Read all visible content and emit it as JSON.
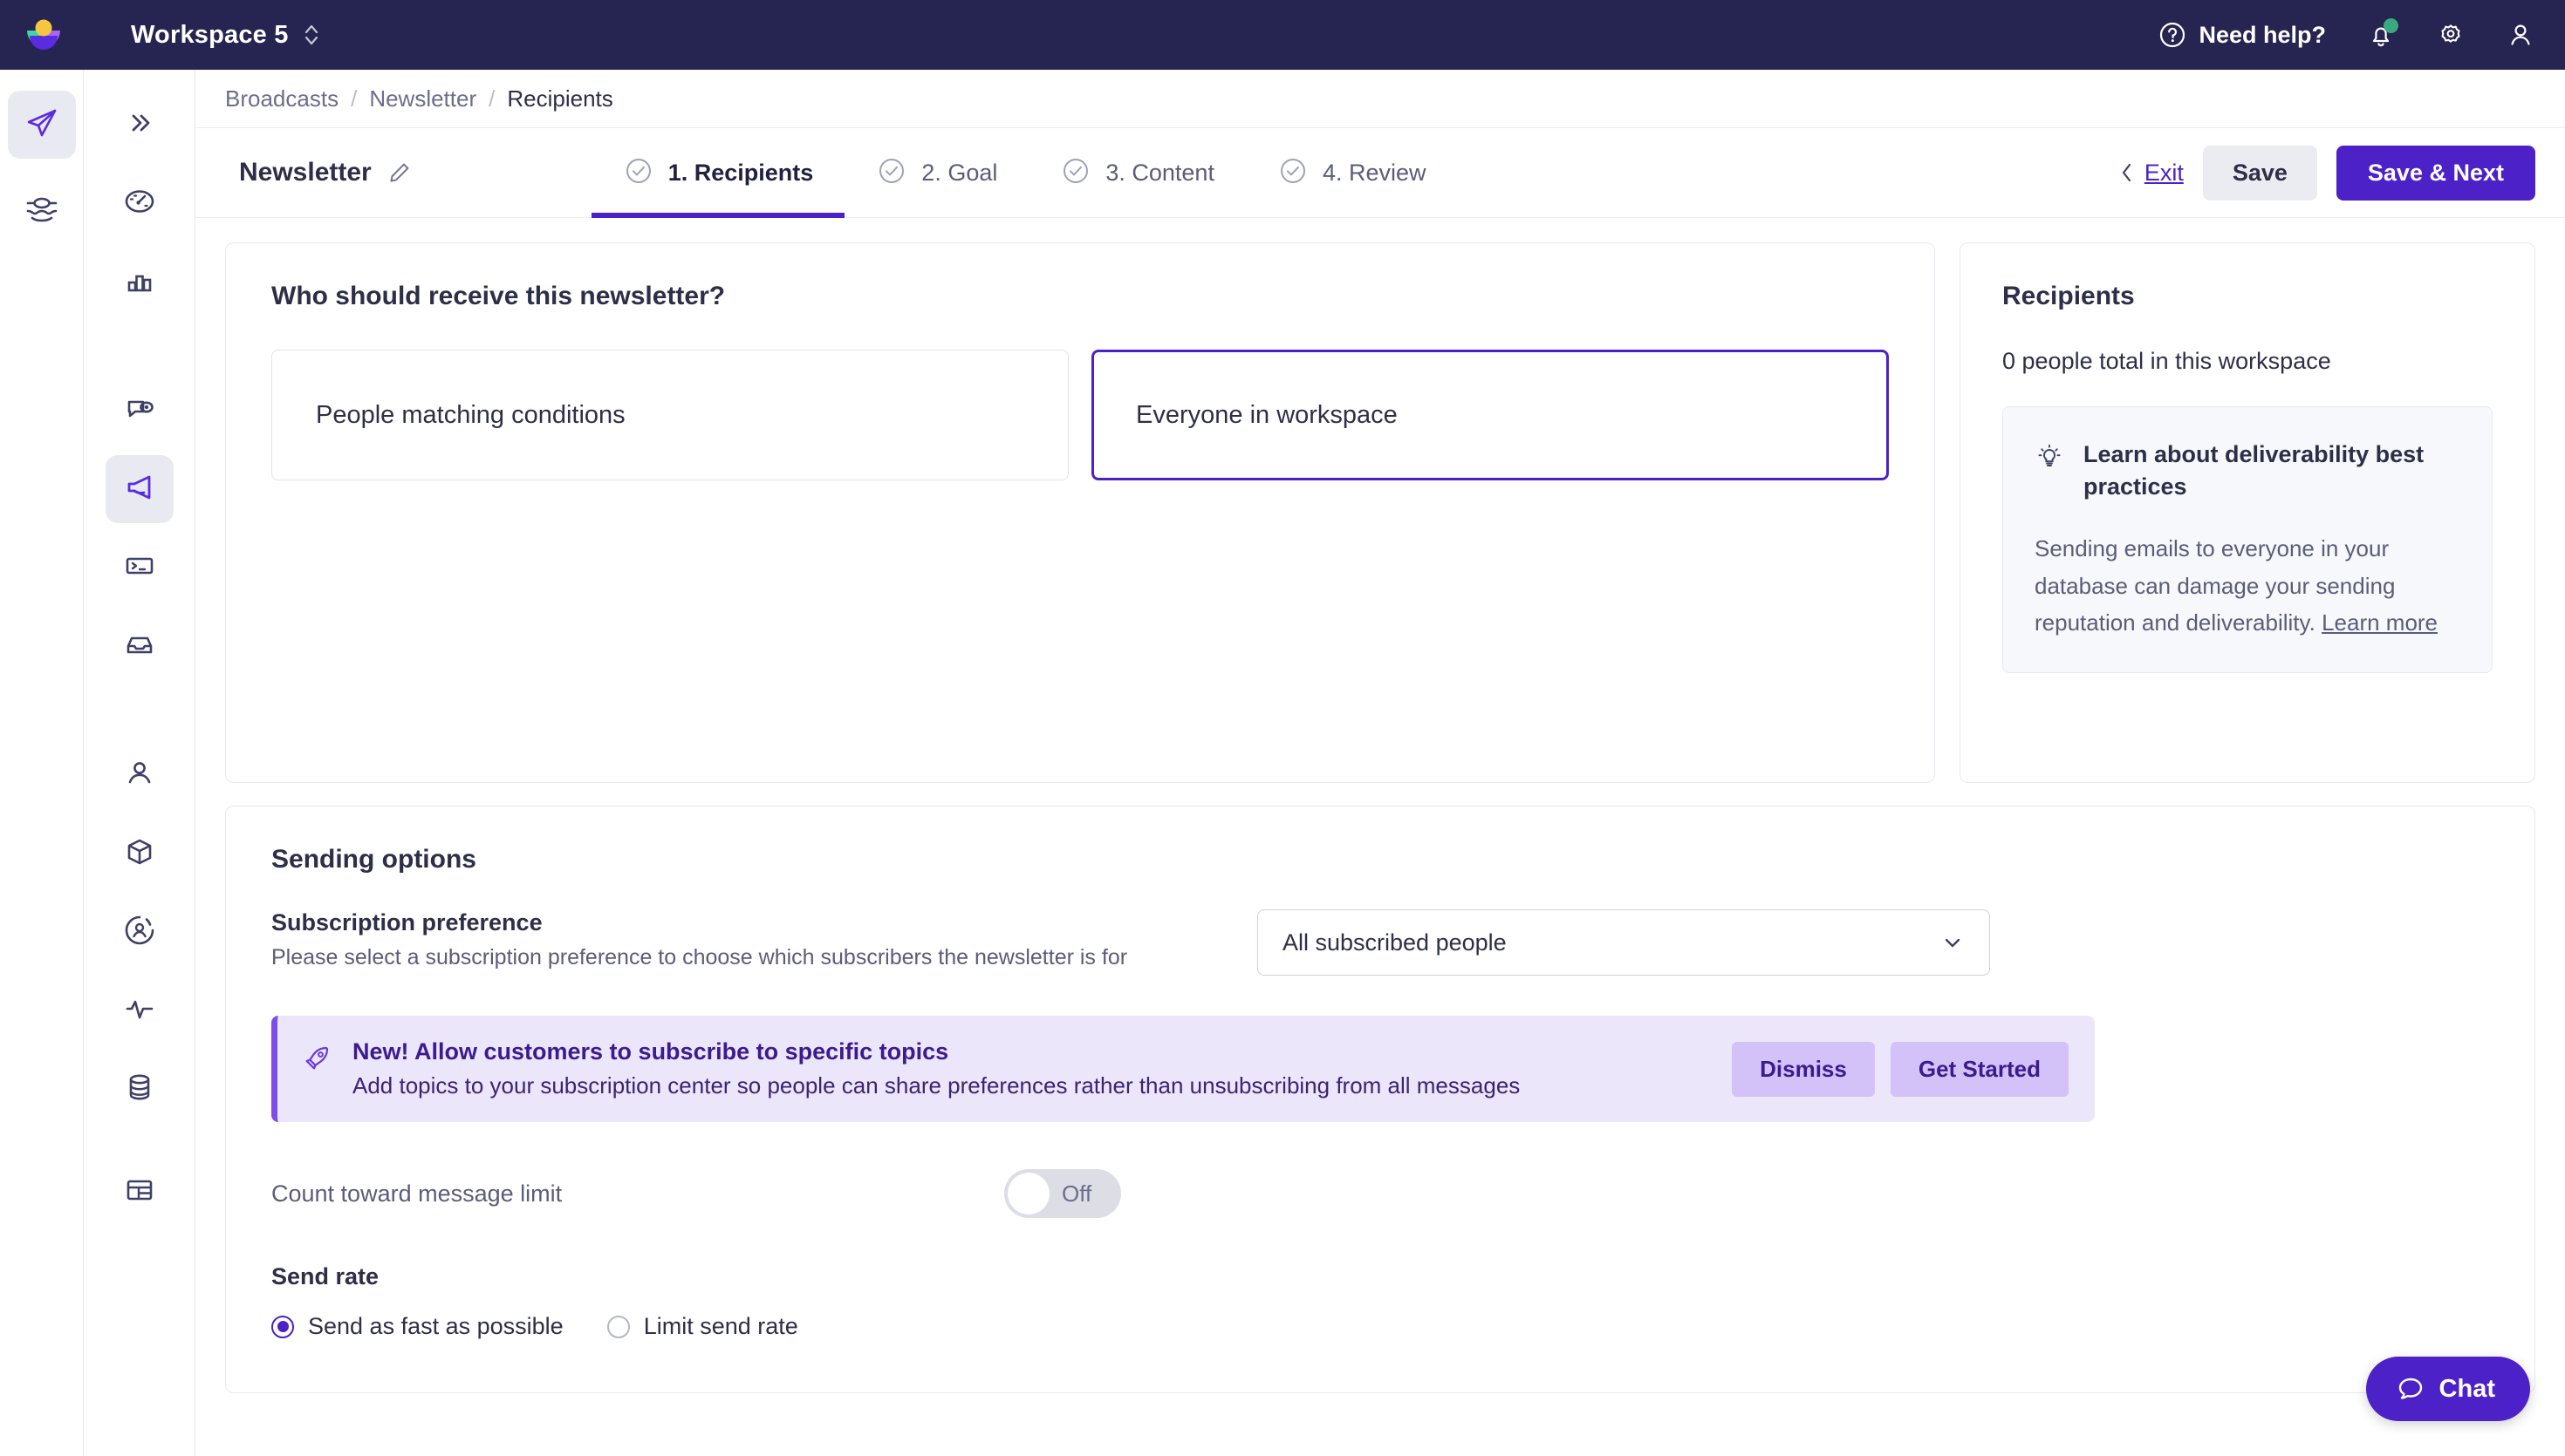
{
  "topbar": {
    "logo_icon": "app-logo",
    "workspace_name": "Workspace 5",
    "workspace_switch_icon": "chevron-updown-icon",
    "need_help_label": "Need help?",
    "help_icon": "question-circle-icon",
    "notifications_icon": "bell-icon",
    "settings_icon": "gear-icon",
    "account_icon": "user-icon"
  },
  "rail_a": {
    "items": [
      {
        "icon": "paper-plane-icon",
        "active": true
      },
      {
        "icon": "layers-icon",
        "active": false
      }
    ]
  },
  "rail_b": {
    "items": [
      {
        "icon": "chevrons-right-icon",
        "active": false
      },
      {
        "icon": "gauge-icon",
        "active": false
      },
      {
        "icon": "bar-chart-icon",
        "active": false
      },
      {
        "icon": "message-eye-icon",
        "active": false
      },
      {
        "icon": "megaphone-icon",
        "active": true
      },
      {
        "icon": "terminal-icon",
        "active": false
      },
      {
        "icon": "inbox-icon",
        "active": false
      },
      {
        "icon": "person-icon",
        "active": false
      },
      {
        "icon": "box-icon",
        "active": false
      },
      {
        "icon": "user-circle-icon",
        "active": false
      },
      {
        "icon": "activity-icon",
        "active": false
      },
      {
        "icon": "database-icon",
        "active": false
      },
      {
        "icon": "table-layout-icon",
        "active": false
      }
    ]
  },
  "breadcrumb": {
    "items": [
      "Broadcasts",
      "Newsletter",
      "Recipients"
    ],
    "separator": "/"
  },
  "wizard": {
    "doc_title": "Newsletter",
    "edit_icon": "pencil-icon",
    "steps": [
      {
        "label": "1. Recipients",
        "icon": "check-circle-icon",
        "active": true
      },
      {
        "label": "2. Goal",
        "icon": "check-circle-icon",
        "active": false
      },
      {
        "label": "3. Content",
        "icon": "check-circle-icon",
        "active": false
      },
      {
        "label": "4. Review",
        "icon": "check-circle-icon",
        "active": false
      }
    ],
    "exit_label": "Exit",
    "exit_icon": "chevron-left-icon",
    "save_label": "Save",
    "save_next_label": "Save & Next"
  },
  "recipients_card": {
    "heading": "Who should receive this newsletter?",
    "choices": [
      {
        "label": "People matching conditions",
        "selected": false
      },
      {
        "label": "Everyone in workspace",
        "selected": true
      }
    ]
  },
  "summary_panel": {
    "title": "Recipients",
    "count_text": "0 people total in this workspace",
    "tip": {
      "icon": "lightbulb-icon",
      "title": "Learn about deliverability best practices",
      "body": "Sending emails to everyone in your database can damage your sending reputation and deliverability.",
      "link_label": "Learn more"
    }
  },
  "sending_options": {
    "title": "Sending options",
    "subscription": {
      "label": "Subscription preference",
      "help": "Please select a subscription preference to choose which subscribers the newsletter is for",
      "selected_value": "All subscribed people",
      "chevron_icon": "chevron-down-icon"
    },
    "promo": {
      "icon": "rocket-icon",
      "title": "New! Allow customers to subscribe to specific topics",
      "subtitle": "Add topics to your subscription center so people can share preferences rather than unsubscribing from all messages",
      "dismiss_label": "Dismiss",
      "get_started_label": "Get Started"
    },
    "message_limit": {
      "label": "Count toward message limit",
      "state_label": "Off",
      "on": false
    },
    "send_rate": {
      "label": "Send rate",
      "options": [
        {
          "label": "Send as fast as possible",
          "selected": true
        },
        {
          "label": "Limit send rate",
          "selected": false
        }
      ]
    }
  },
  "chat_widget": {
    "label": "Chat",
    "icon": "chat-bubble-icon"
  },
  "colors": {
    "brand_purple": "#4c21c7",
    "navy": "#262450",
    "promo_bg": "#ece6fb",
    "promo_btn": "#d3c2f7",
    "badge_green": "#3aa981"
  }
}
